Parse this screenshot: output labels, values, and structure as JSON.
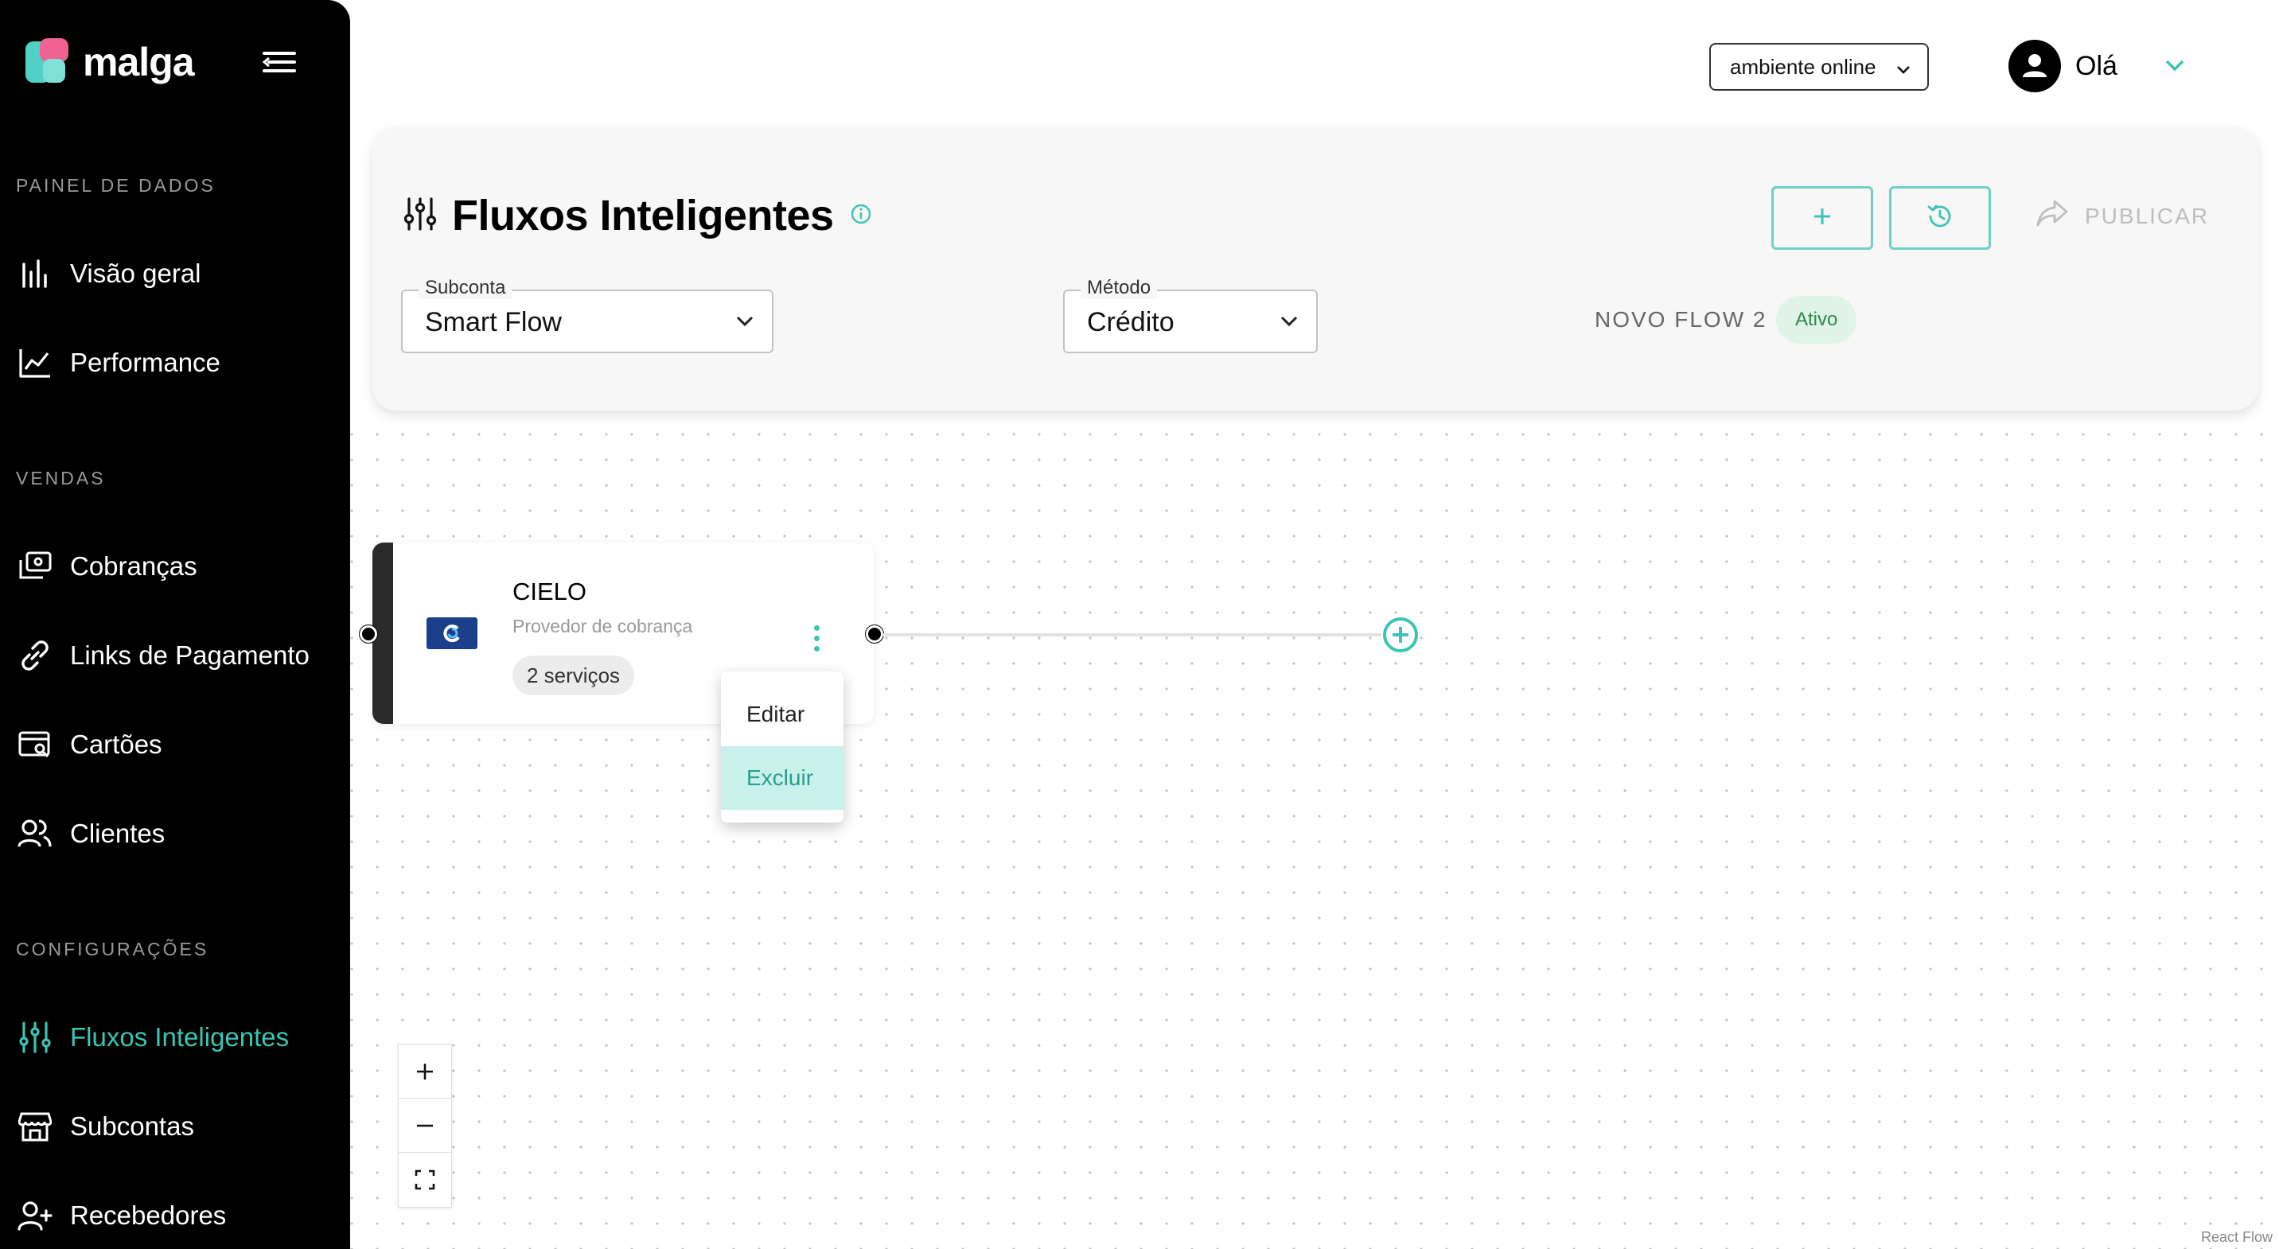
{
  "brand": {
    "name": "malga"
  },
  "sidebar": {
    "sections": [
      {
        "title": "PAINEL DE DADOS",
        "items": [
          {
            "label": "Visão geral",
            "icon": "bar-chart-icon"
          },
          {
            "label": "Performance",
            "icon": "line-chart-icon"
          }
        ]
      },
      {
        "title": "VENDAS",
        "items": [
          {
            "label": "Cobranças",
            "icon": "charges-icon"
          },
          {
            "label": "Links de Pagamento",
            "icon": "link-icon"
          },
          {
            "label": "Cartões",
            "icon": "card-search-icon"
          },
          {
            "label": "Clientes",
            "icon": "users-icon"
          }
        ]
      },
      {
        "title": "CONFIGURAÇÕES",
        "items": [
          {
            "label": "Fluxos Inteligentes",
            "icon": "sliders-icon",
            "active": true
          },
          {
            "label": "Subcontas",
            "icon": "store-icon"
          },
          {
            "label": "Recebedores",
            "icon": "user-plus-icon"
          }
        ]
      }
    ]
  },
  "topbar": {
    "environment": "ambiente online",
    "greeting": "Olá"
  },
  "header": {
    "title": "Fluxos Inteligentes",
    "publish_label": "PUBLICAR",
    "subaccount": {
      "label": "Subconta",
      "value": "Smart Flow"
    },
    "method": {
      "label": "Método",
      "value": "Crédito"
    },
    "flow_name": "NOVO FLOW 2",
    "status": "Ativo"
  },
  "node": {
    "title": "CIELO",
    "subtitle": "Provedor de cobrança",
    "chip": "2 serviços"
  },
  "context_menu": {
    "items": [
      {
        "label": "Editar",
        "active": false
      },
      {
        "label": "Excluir",
        "active": true
      }
    ]
  },
  "attribution": "React Flow",
  "colors": {
    "accent": "#3cc4b4",
    "sidebar_bg": "#000000",
    "status_bg": "#dff3e6"
  }
}
